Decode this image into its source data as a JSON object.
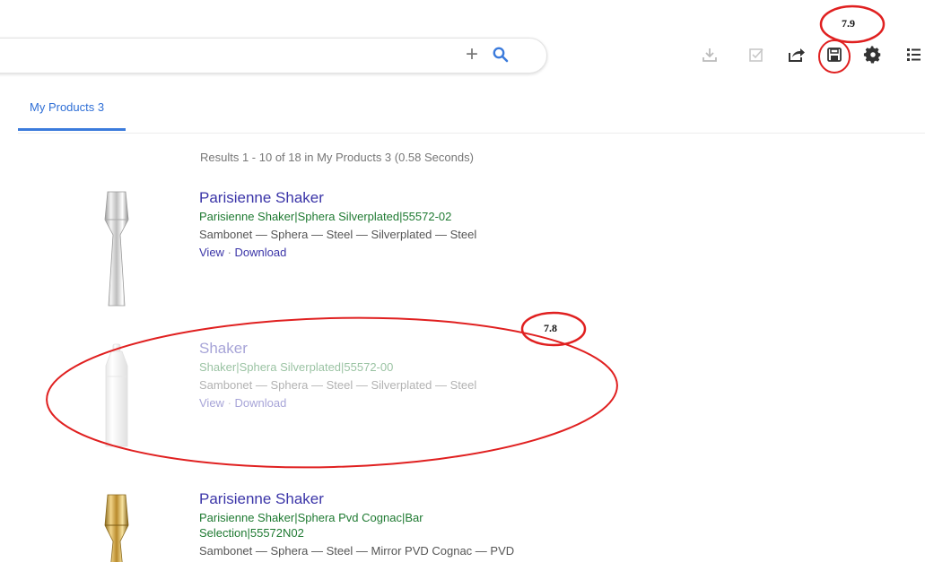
{
  "search": {
    "value": "",
    "placeholder": ""
  },
  "toolbar": {
    "icons": [
      "download-icon",
      "checklist-icon",
      "share-icon",
      "save-icon",
      "gear-icon",
      "list-view-icon"
    ]
  },
  "tabs": [
    {
      "label": "My Products 3",
      "active": true
    }
  ],
  "results_summary": "Results 1 - 10 of 18 in My Products 3 (0.58 Seconds)",
  "results": [
    {
      "title": "Parisienne Shaker",
      "subtitle": "Parisienne Shaker|Sphera Silverplated|55572-02",
      "attributes": "Sambonet — Sphera — Steel — Silverplated — Steel",
      "view": "View",
      "separator": "·",
      "download": "Download",
      "finish": "silver"
    },
    {
      "title": "Shaker",
      "subtitle": "Shaker|Sphera Silverplated|55572-00",
      "attributes": "Sambonet — Sphera — Steel — Silverplated — Steel",
      "view": "View",
      "separator": "·",
      "download": "Download",
      "finish": "silver"
    },
    {
      "title": "Parisienne Shaker",
      "subtitle": "Parisienne Shaker|Sphera Pvd Cognac|Bar Selection|55572N02",
      "attributes": "Sambonet — Sphera — Steel — Mirror PVD Cognac — PVD",
      "finish": "gold"
    }
  ],
  "annotations": [
    {
      "label": "7.9"
    },
    {
      "label": "7.8"
    }
  ],
  "colors": {
    "link": "#3b35a8",
    "subtitle": "#1f7a32",
    "tab_active": "#2f6fd6",
    "annotation": "#e02020"
  }
}
